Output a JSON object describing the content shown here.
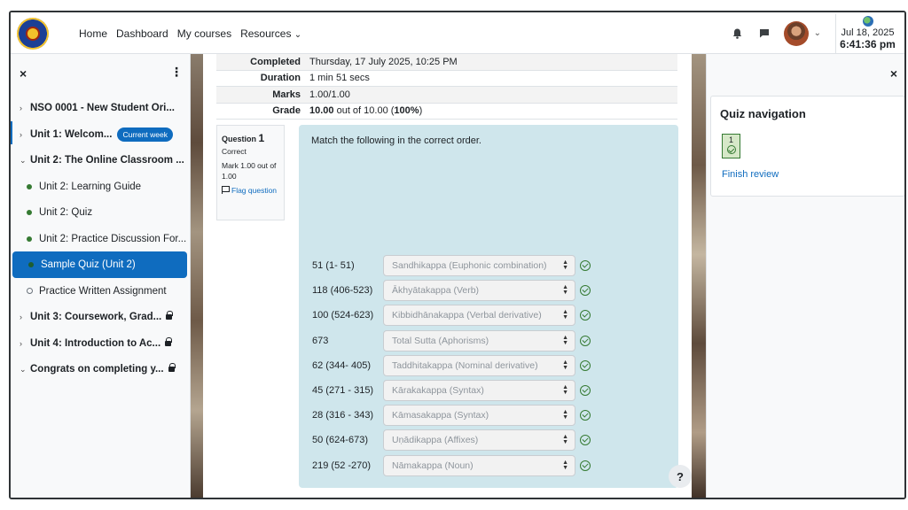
{
  "navbar": {
    "links": [
      "Home",
      "Dashboard",
      "My courses",
      "Resources"
    ],
    "resources_caret": "⌄",
    "clock": {
      "date": "Jul 18, 2025",
      "time": "6:41:36 pm"
    }
  },
  "drawer": {
    "close": "×",
    "kebab": "⋮",
    "items": [
      {
        "label": "NSO 0001 - New Student Ori...",
        "kind": "section",
        "chev": "›"
      },
      {
        "label": "Unit 1: Welcom...",
        "kind": "section",
        "chev": "›",
        "badge": "Current week"
      },
      {
        "label": "Unit 2: The Online Classroom ...",
        "kind": "section",
        "chev": "⌄"
      },
      {
        "label": "Unit 2: Learning Guide",
        "kind": "activity",
        "status": "done"
      },
      {
        "label": "Unit 2: Quiz",
        "kind": "activity",
        "status": "done"
      },
      {
        "label": "Unit 2: Practice Discussion For...",
        "kind": "activity",
        "status": "done"
      },
      {
        "label": "Sample Quiz (Unit 2)",
        "kind": "activity",
        "status": "done",
        "active": true
      },
      {
        "label": "Practice Written Assignment",
        "kind": "activity",
        "status": "todo"
      },
      {
        "label": "Unit 3: Coursework, Grad...",
        "kind": "section",
        "chev": "›",
        "locked": true
      },
      {
        "label": "Unit 4: Introduction to Ac...",
        "kind": "section",
        "chev": "›",
        "locked": true
      },
      {
        "label": "Congrats on completing y...",
        "kind": "section",
        "chev": "⌄",
        "locked": true
      }
    ]
  },
  "summary": [
    {
      "key": "Completed",
      "value": "Thursday, 17 July 2025, 10:25 PM"
    },
    {
      "key": "Duration",
      "value": "1 min 51 secs"
    },
    {
      "key": "Marks",
      "value": "1.00/1.00"
    },
    {
      "key": "Grade",
      "value_bold": "10.00",
      "value_mid": " out of 10.00 (",
      "value_pct": "100%",
      "value_end": ")"
    }
  ],
  "question": {
    "label": "Question",
    "number": "1",
    "state": "Correct",
    "mark": "Mark 1.00 out of 1.00",
    "flag": "Flag question",
    "text": "Match the following in the correct order.",
    "rows": [
      {
        "left": "51 (1- 51)",
        "answer": "Sandhikappa (Euphonic combination)"
      },
      {
        "left": "118 (406-523)",
        "answer": "Ākhyātakappa (Verb)"
      },
      {
        "left": "100 (524-623)",
        "answer": "Kibbidhānakappa (Verbal derivative)"
      },
      {
        "left": "673",
        "answer": "Total Sutta (Aphorisms)"
      },
      {
        "left": "62 (344- 405)",
        "answer": "Taddhitakappa (Nominal derivative)"
      },
      {
        "left": "45 (271 - 315)",
        "answer": "Kārakakappa (Syntax)"
      },
      {
        "left": "28 (316 - 343)",
        "answer": "Kāmasakappa (Syntax)"
      },
      {
        "left": "50 (624-673)",
        "answer": "Uṇādikappa (Affixes)"
      },
      {
        "left": "219 (52 -270)",
        "answer": "Nāmakappa (Noun)"
      }
    ],
    "help": "?"
  },
  "quiz_nav": {
    "close": "×",
    "title": "Quiz navigation",
    "button_number": "1",
    "finish": "Finish review"
  },
  "colors": {
    "primary": "#0f6cbf",
    "success": "#357a32",
    "question_bg": "#cfe6ec"
  }
}
